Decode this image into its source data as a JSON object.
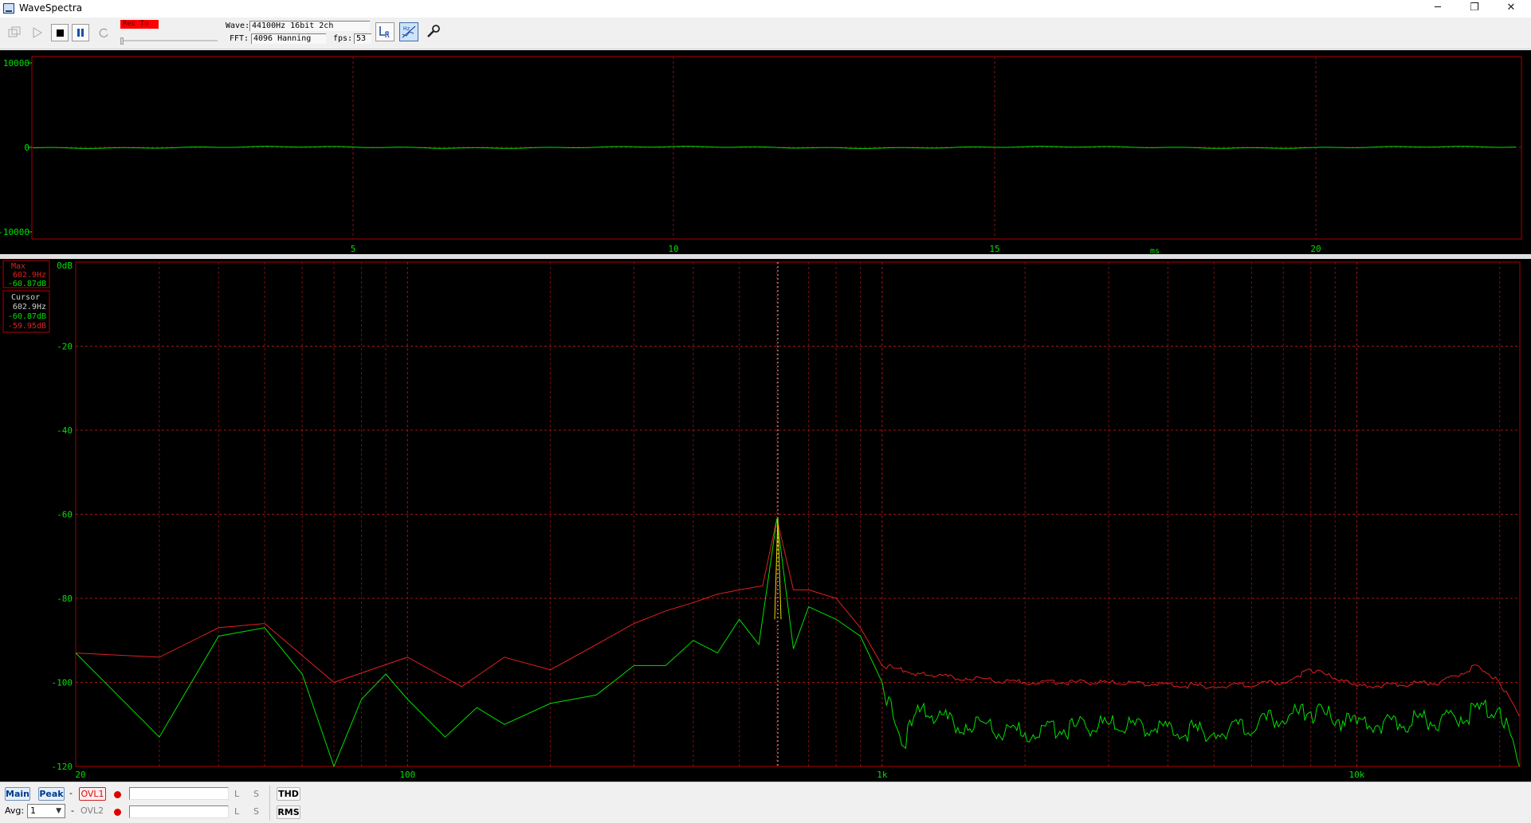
{
  "window": {
    "title": "WaveSpectra",
    "controls": {
      "minimize": "─",
      "restore": "❐",
      "close": "✕"
    }
  },
  "toolbar": {
    "rec_label": "Rec To",
    "wave_label": "Wave:",
    "wave_value": "44100Hz 16bit 2ch",
    "fft_label": "FFT:",
    "fft_value": "4096 Hanning",
    "fps_label": "fps:",
    "fps_value": "53",
    "icons": [
      "monitor-icon",
      "play-icon",
      "stop-icon",
      "pause-icon",
      "reload-icon",
      "lr-channel-icon",
      "hz-scale-icon",
      "settings-wrench-icon"
    ]
  },
  "waveform": {
    "y_ticks": [
      "10000",
      "0",
      "-10000"
    ],
    "x_ticks": [
      "5",
      "10",
      "15",
      "20"
    ],
    "x_unit": "ms",
    "color_trace": "#00e000",
    "color_frame": "#b00000"
  },
  "spectrum": {
    "y_ticks": [
      "0dB",
      "-20",
      "-40",
      "-60",
      "-80",
      "-100",
      "-120"
    ],
    "x_ticks": [
      "20",
      "100",
      "1k",
      "10k"
    ],
    "max_box": {
      "label": "Max",
      "freq": "602.9Hz",
      "level": "-60.87dB"
    },
    "cursor_box": {
      "label": "Cursor",
      "freq": "602.9Hz",
      "level_l": "-60.87dB",
      "level_r": "-59.95dB"
    },
    "colors": {
      "l_channel": "#00e000",
      "r_channel": "#e02020",
      "peak_line": "#e0e000"
    }
  },
  "statusbar": {
    "main_button": "Main",
    "peak_button": "Peak",
    "dash": "-",
    "ovl1_label": "OVL1",
    "ovl2_label": "OVL2",
    "l_label": "L",
    "s_label": "S",
    "thd_button": "THD",
    "rms_button": "RMS",
    "avg_label": "Avg:",
    "avg_value": "1"
  },
  "chart_data": {
    "type": "line",
    "xscale": "log",
    "xlim": [
      20,
      22050
    ],
    "ylim": [
      -120,
      0
    ],
    "xlabel": "",
    "ylabel": "",
    "x_ticks": [
      "20",
      "100",
      "1k",
      "10k"
    ],
    "y_ticks": [
      "0dB",
      "-20",
      "-40",
      "-60",
      "-80",
      "-100",
      "-120"
    ],
    "series": [
      {
        "color": "#e02020",
        "x": [
          20,
          30,
          40,
          50,
          70,
          100,
          130,
          160,
          200,
          250,
          300,
          350,
          400,
          450,
          500,
          560,
          600,
          650,
          700,
          800,
          900,
          1000,
          1200,
          1500,
          2000,
          3000,
          5000,
          7000,
          8000,
          9000,
          10000,
          15000,
          18000,
          20000,
          22000
        ],
        "y": [
          -93,
          -94,
          -87,
          -86,
          -100,
          -94,
          -101,
          -94,
          -97,
          -91,
          -86,
          -83,
          -81,
          -79,
          -78,
          -77,
          -61,
          -78,
          -78,
          -80,
          -87,
          -96,
          -98,
          -99,
          -100,
          -100,
          -101,
          -100,
          -97,
          -99,
          -101,
          -100,
          -96,
          -100,
          -108
        ]
      },
      {
        "color": "#00e000",
        "x": [
          20,
          30,
          40,
          50,
          60,
          70,
          80,
          90,
          100,
          120,
          140,
          160,
          200,
          250,
          300,
          350,
          400,
          450,
          500,
          550,
          600,
          650,
          700,
          800,
          900,
          1000,
          1100,
          1200,
          1500,
          2000,
          3000,
          5000,
          8000,
          10000,
          15000,
          20000,
          22000
        ],
        "y": [
          -93,
          -113,
          -89,
          -87,
          -98,
          -120,
          -104,
          -98,
          -104,
          -113,
          -106,
          -110,
          -105,
          -103,
          -96,
          -96,
          -90,
          -93,
          -85,
          -91,
          -61,
          -92,
          -82,
          -85,
          -89,
          -100,
          -115,
          -107,
          -110,
          -112,
          -110,
          -112,
          -107,
          -110,
          -109,
          -106,
          -120
        ]
      }
    ],
    "markers": [
      {
        "x": 602.9,
        "y": -60.87,
        "label": "peak"
      }
    ]
  }
}
